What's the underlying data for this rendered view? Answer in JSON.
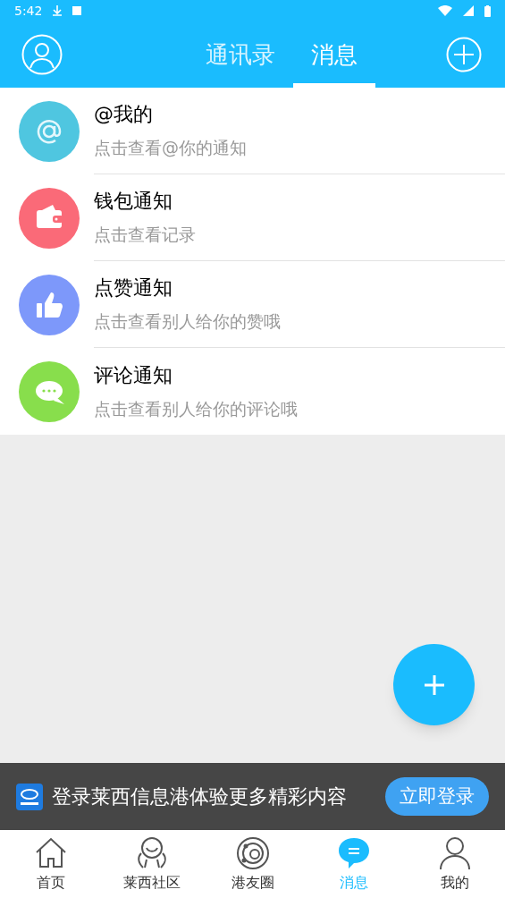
{
  "status_bar": {
    "time": "5:42"
  },
  "header": {
    "tabs": [
      {
        "label": "通讯录",
        "selected": false
      },
      {
        "label": "消息",
        "selected": true
      }
    ]
  },
  "messages": [
    {
      "title": "@我的",
      "subtitle": "点击查看@你的通知",
      "color": "#4fc6e0"
    },
    {
      "title": "钱包通知",
      "subtitle": "点击查看记录",
      "color": "#fa6a78"
    },
    {
      "title": "点赞通知",
      "subtitle": "点击查看别人给你的赞哦",
      "color": "#7d98fa"
    },
    {
      "title": "评论通知",
      "subtitle": "点击查看别人给你的评论哦",
      "color": "#88de4c"
    }
  ],
  "login_banner": {
    "text": "登录莱西信息港体验更多精彩内容",
    "button": "立即登录"
  },
  "bottom_nav": [
    {
      "label": "首页",
      "selected": false
    },
    {
      "label": "莱西社区",
      "selected": false
    },
    {
      "label": "港友圈",
      "selected": false
    },
    {
      "label": "消息",
      "selected": true
    },
    {
      "label": "我的",
      "selected": false
    }
  ]
}
